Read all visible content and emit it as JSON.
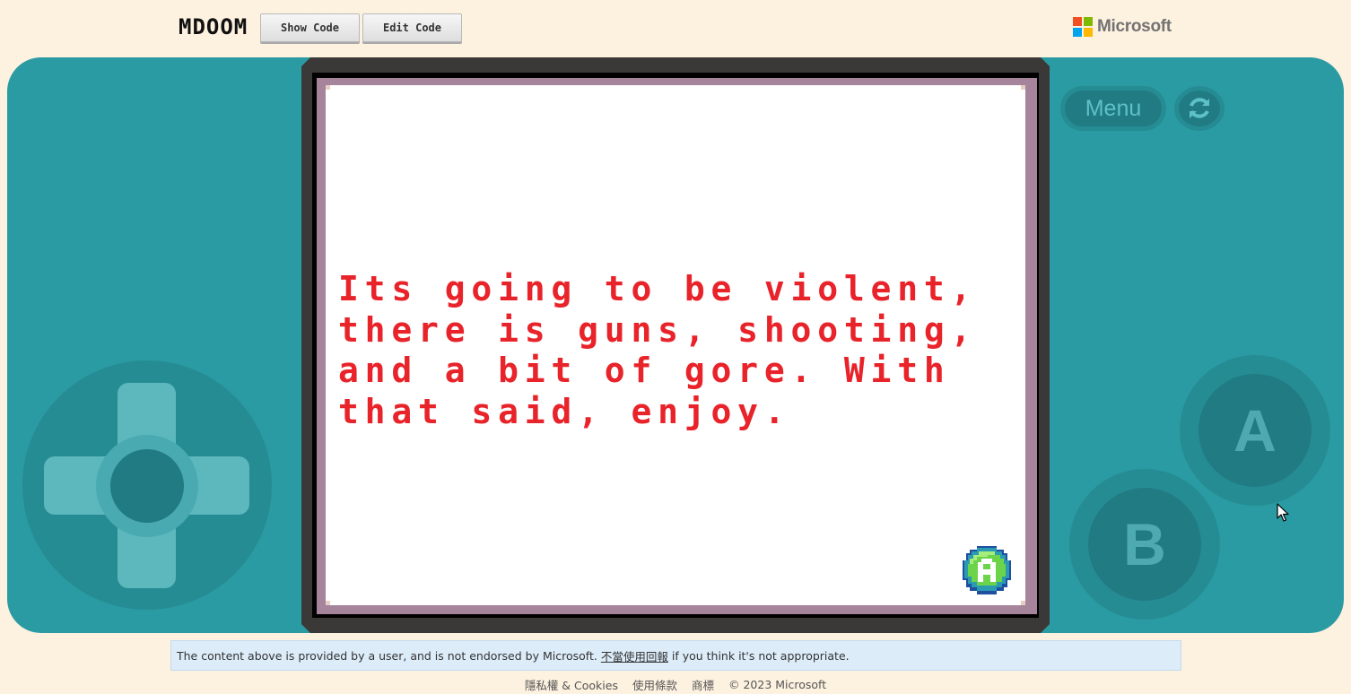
{
  "header": {
    "game_title": "MDOOM",
    "show_code_label": "Show Code",
    "edit_code_label": "Edit Code",
    "brand": "Microsoft",
    "brand_colors": [
      "#f25022",
      "#7fba00",
      "#00a4ef",
      "#ffb900"
    ]
  },
  "game": {
    "dialog_text": "Its going to be violent,\nthere is guns, shooting,\nand a bit of gore. With\nthat said, enjoy.",
    "dialog_color": "#e8232a",
    "prompt_button": "A"
  },
  "controls": {
    "menu_label": "Menu",
    "a_label": "A",
    "b_label": "B",
    "restart_icon": "refresh-icon"
  },
  "notice": {
    "text_before": "The content above is provided by a user, and is not endorsed by Microsoft.",
    "link_text": "不當使用回報",
    "text_after": "if you think it's not appropriate."
  },
  "footer": {
    "privacy": "隱私權 & Cookies",
    "terms": "使用條款",
    "trademarks": "商標",
    "copyright": "© 2023 Microsoft"
  }
}
